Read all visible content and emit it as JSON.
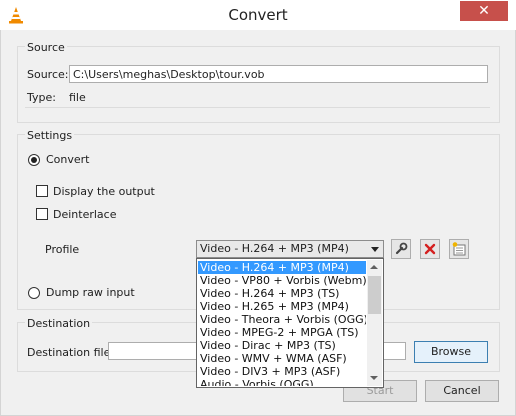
{
  "window": {
    "title": "Convert",
    "close_glyph": "✕",
    "app_icon": "vlc-cone-icon"
  },
  "source": {
    "group_title": "Source",
    "source_label": "Source:",
    "source_value": "C:\\Users\\meghas\\Desktop\\tour.vob",
    "type_label": "Type:",
    "type_value": "file"
  },
  "settings": {
    "group_title": "Settings",
    "convert_label": "Convert",
    "convert_selected": true,
    "display_output_label": "Display the output",
    "display_output_checked": false,
    "deinterlace_label": "Deinterlace",
    "deinterlace_checked": false,
    "profile_label": "Profile",
    "profile_selected": "Video - H.264 + MP3 (MP4)",
    "profile_buttons": [
      "wrench-icon",
      "delete-icon",
      "new-profile-icon"
    ],
    "dump_raw_label": "Dump raw input",
    "dump_raw_selected": false
  },
  "profile_options": [
    "Video - H.264 + MP3 (MP4)",
    "Video - VP80 + Vorbis (Webm)",
    "Video - H.264 + MP3 (TS)",
    "Video - H.265 + MP3 (MP4)",
    "Video - Theora + Vorbis (OGG)",
    "Video - MPEG-2 + MPGA (TS)",
    "Video - Dirac + MP3 (TS)",
    "Video - WMV + WMA (ASF)",
    "Video - DIV3 + MP3 (ASF)",
    "Audio - Vorbis (OGG)"
  ],
  "destination": {
    "group_title": "Destination",
    "file_label": "Destination file:",
    "file_value": "",
    "browse_label": "Browse"
  },
  "footer": {
    "start_label": "Start",
    "cancel_label": "Cancel"
  },
  "colors": {
    "selection": "#3399ff",
    "close": "#c7504b",
    "delete_red": "#d42020"
  }
}
